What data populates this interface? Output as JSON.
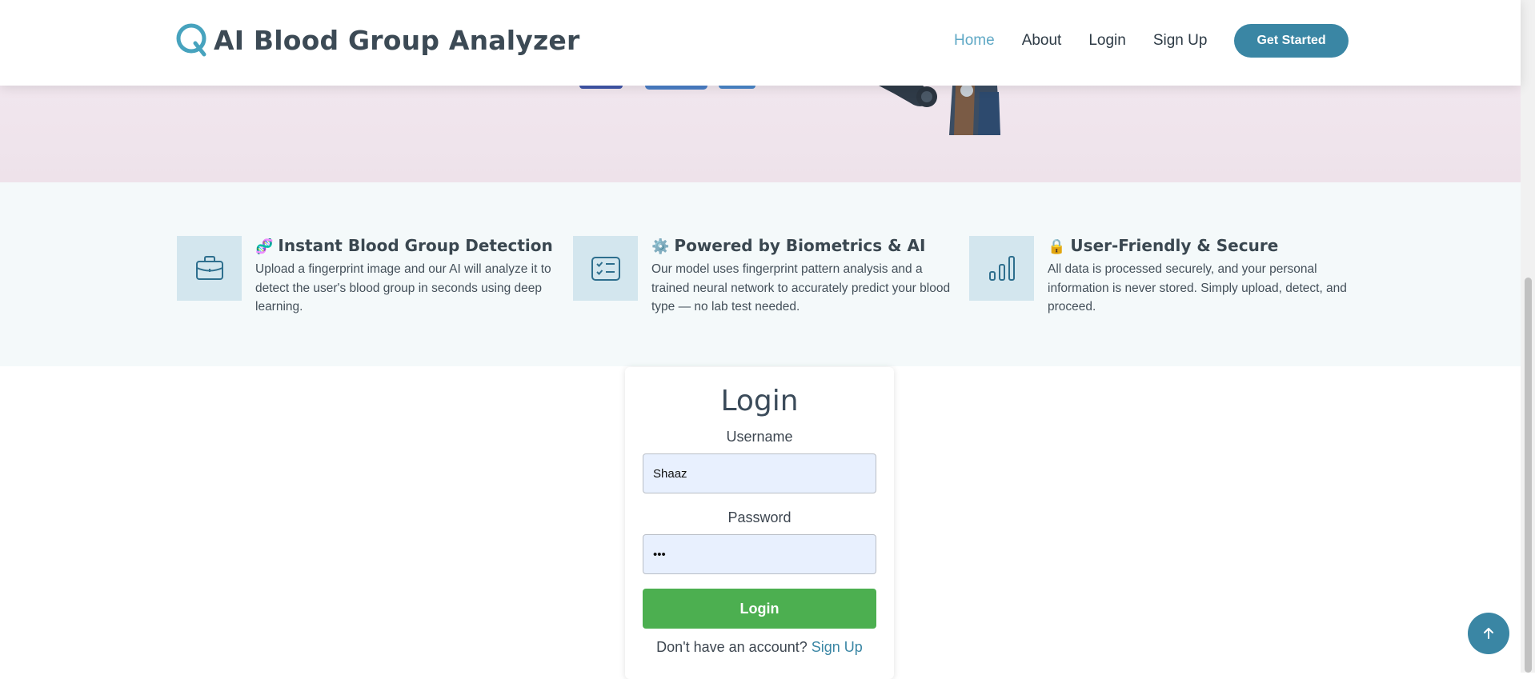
{
  "header": {
    "logo_text": "AI Blood Group Analyzer",
    "nav": [
      {
        "label": "Home",
        "active": true
      },
      {
        "label": "About"
      },
      {
        "label": "Login"
      },
      {
        "label": "Sign Up"
      }
    ],
    "cta_label": "Get Started"
  },
  "features": [
    {
      "icon": "briefcase-icon",
      "emoji": "🧬",
      "title": "Instant Blood Group Detection",
      "description": "Upload a fingerprint image and our AI will analyze it to detect the user's blood group in seconds using deep learning."
    },
    {
      "icon": "checklist-icon",
      "emoji": "⚙️",
      "title": "Powered by Biometrics & AI",
      "description": "Our model uses fingerprint pattern analysis and a trained neural network to accurately predict your blood type — no lab test needed."
    },
    {
      "icon": "bar-chart-icon",
      "emoji": "🔒",
      "title": "User-Friendly & Secure",
      "description": "All data is processed securely, and your personal information is never stored. Simply upload, detect, and proceed."
    }
  ],
  "login": {
    "title": "Login",
    "username_label": "Username",
    "username_value": "Shaaz",
    "password_label": "Password",
    "password_value": "•••",
    "submit_label": "Login",
    "signup_prompt": "Don't have an account?",
    "signup_link": "Sign Up"
  },
  "colors": {
    "accent": "#3a86a4",
    "nav_active": "#5fa8c5",
    "login_button": "#4caf50",
    "feature_bg": "#f4f9fa",
    "icon_box_bg": "#d3e6ee",
    "input_bg": "#e8f0fe"
  }
}
